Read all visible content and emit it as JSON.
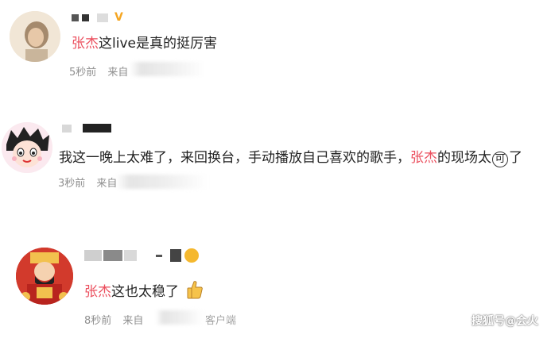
{
  "comments": [
    {
      "mention": "张杰",
      "text": "这live是真的挺厉害",
      "time": "5秒前",
      "source_prefix": "来自",
      "verified_badge": "V"
    },
    {
      "mention_before": "我这一晚上太难了，来回换台，手动播放自己喜欢的歌手，",
      "mention": "张杰",
      "text": "的现场太",
      "trailing_char": "可",
      "trailing_end": "了",
      "time": "3秒前",
      "source_prefix": "来自"
    },
    {
      "mention": "张杰",
      "text": "这也太稳了",
      "time": "8秒前",
      "source_prefix": "来自",
      "source_suffix": "客户端",
      "emoji": "thumbs-up-icon"
    }
  ],
  "watermark": "搜狐号@会火"
}
